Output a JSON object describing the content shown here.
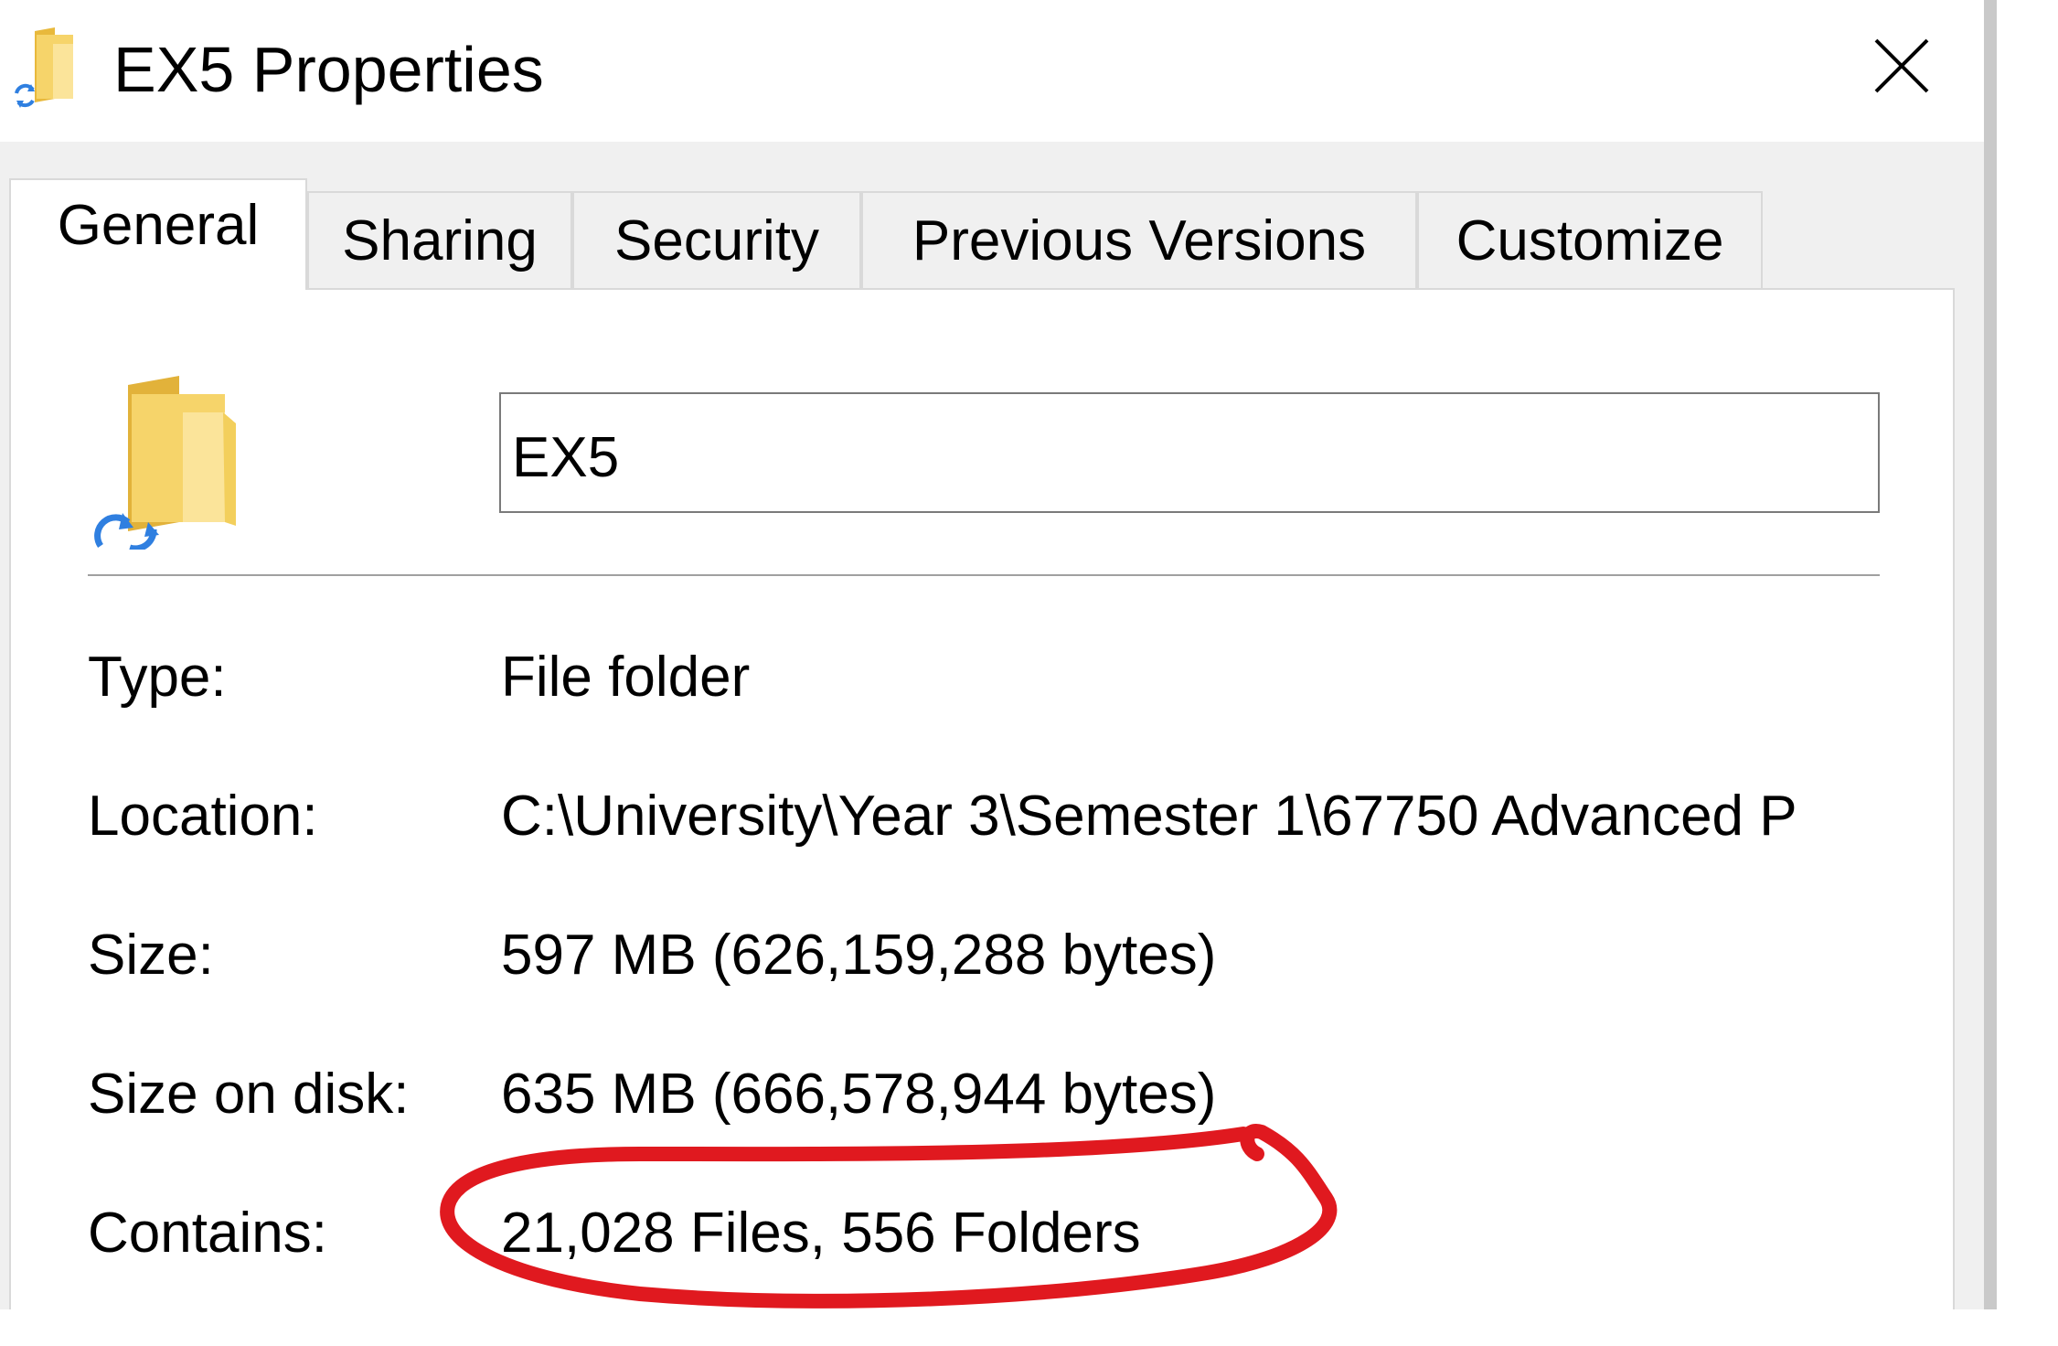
{
  "window": {
    "title": "EX5 Properties",
    "close_icon": "close-icon"
  },
  "tabs": [
    {
      "label": "General",
      "active": true
    },
    {
      "label": "Sharing",
      "active": false
    },
    {
      "label": "Security",
      "active": false
    },
    {
      "label": "Previous Versions",
      "active": false
    },
    {
      "label": "Customize",
      "active": false
    }
  ],
  "general": {
    "icon": "sync-folder-icon",
    "name_value": "EX5",
    "properties": [
      {
        "label": "Type:",
        "value": "File folder"
      },
      {
        "label": "Location:",
        "value": "C:\\University\\Year 3\\Semester 1\\67750 Advanced P"
      },
      {
        "label": "Size:",
        "value": "597 MB (626,159,288 bytes)"
      },
      {
        "label": "Size on disk:",
        "value": "635 MB (666,578,944 bytes)"
      },
      {
        "label": "Contains:",
        "value": "21,028 Files, 556 Folders"
      }
    ]
  },
  "colors": {
    "annotation_circle": "#e0191f",
    "folder_yellow": "#f3cf5c",
    "sync_arrow_blue": "#2f7fe0"
  }
}
